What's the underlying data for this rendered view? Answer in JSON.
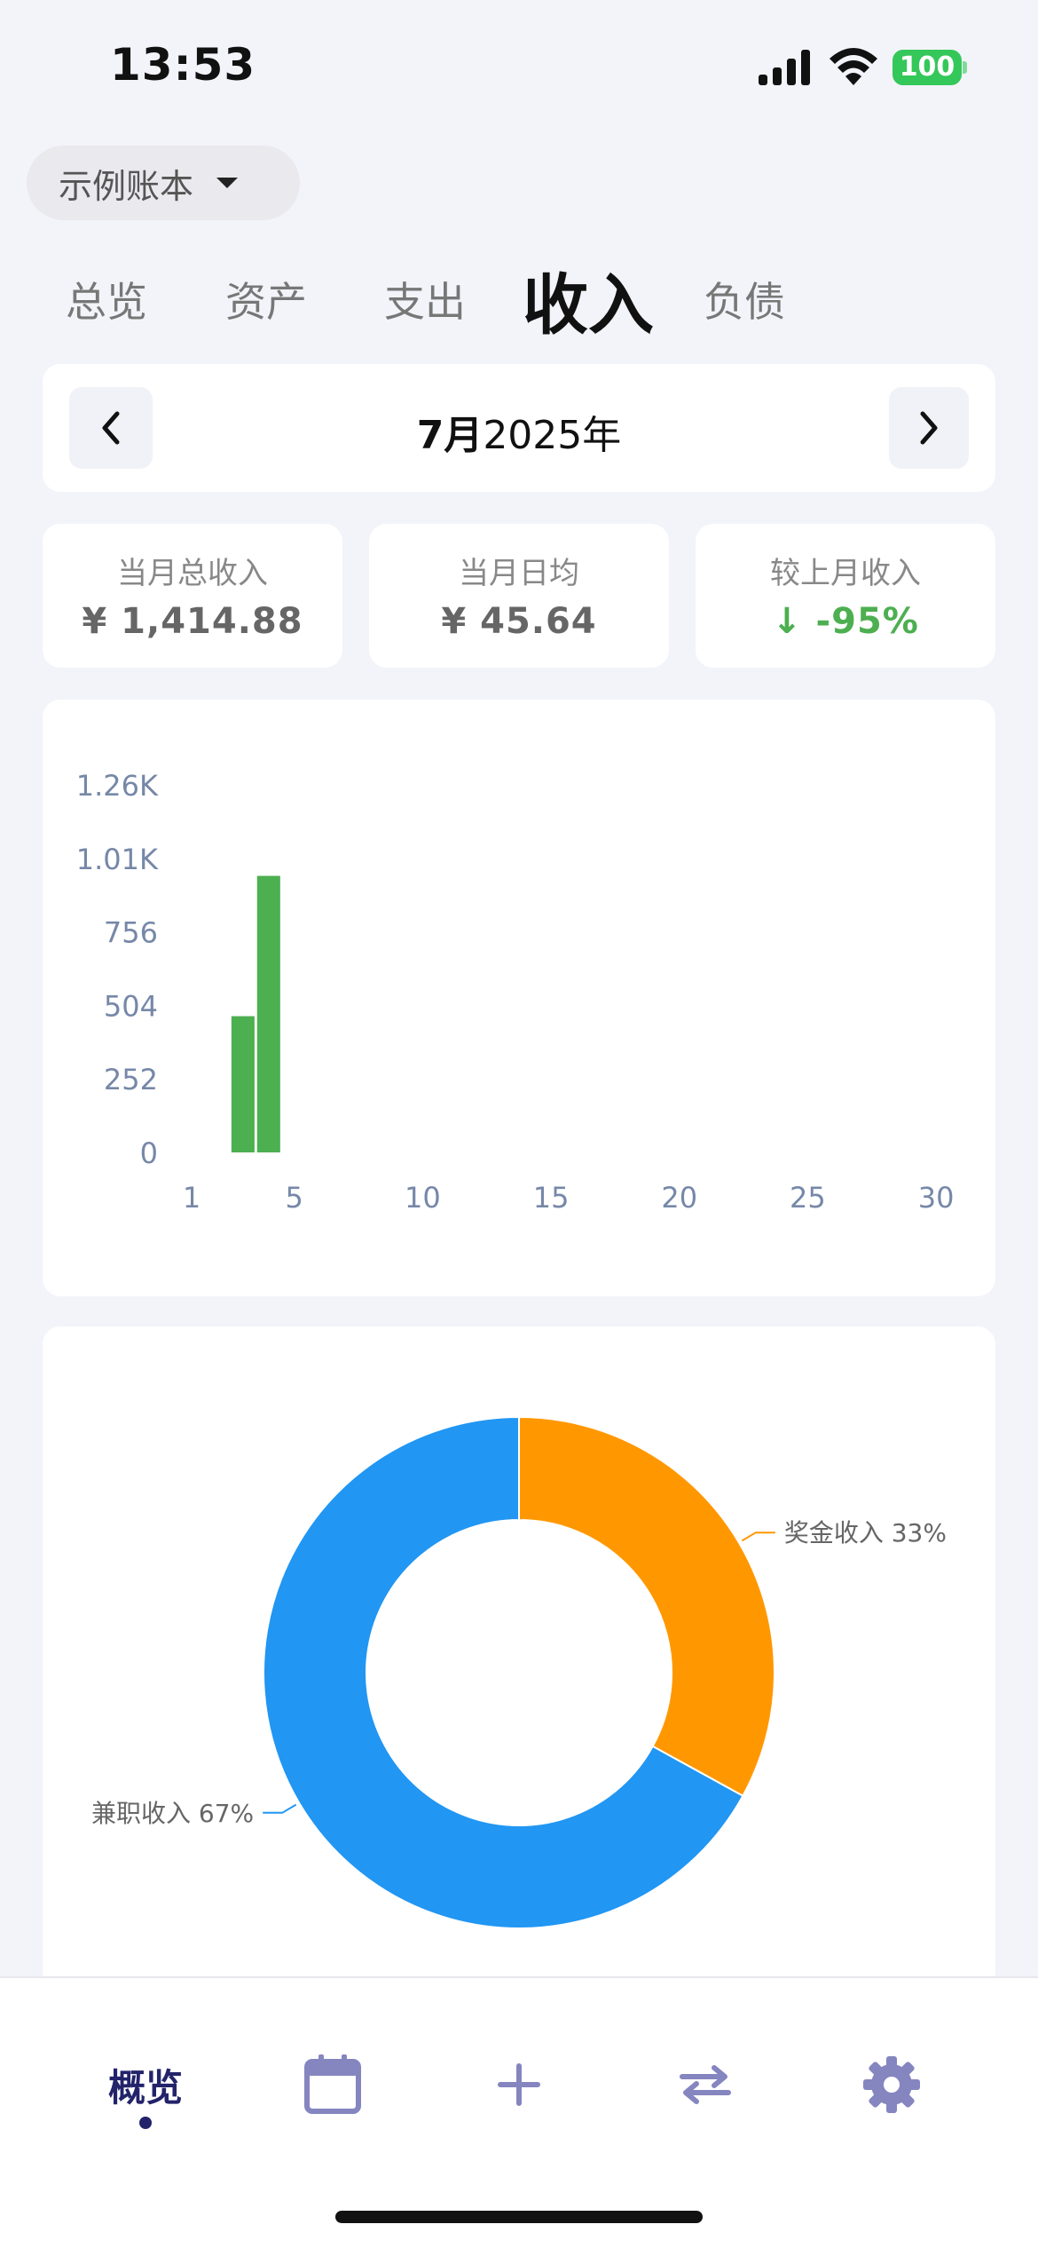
{
  "status_bar": {
    "time": "13:53",
    "battery": "100"
  },
  "book_selector": {
    "name": "示例账本"
  },
  "tabs": [
    {
      "label": "总览",
      "active": false
    },
    {
      "label": "资产",
      "active": false
    },
    {
      "label": "支出",
      "active": false
    },
    {
      "label": "收入",
      "active": true
    },
    {
      "label": "负债",
      "active": false
    }
  ],
  "month_nav": {
    "month": "7月",
    "year": "2025年"
  },
  "stats": [
    {
      "label": "当月总收入",
      "value": "¥ 1,414.88"
    },
    {
      "label": "当月日均",
      "value": "¥ 45.64"
    },
    {
      "label": "较上月收入",
      "value": "↓ -95%"
    }
  ],
  "colors": {
    "bar": "#4caf50",
    "slice_bonus": "#ff9800",
    "slice_parttime": "#2196f3",
    "nav_active": "#23236b",
    "nav_icon": "#8585c0"
  },
  "chart_data": [
    {
      "type": "bar",
      "x": [
        3,
        4
      ],
      "values": [
        467,
        948
      ],
      "ytick_labels": [
        "0",
        "252",
        "504",
        "756",
        "1.01K",
        "1.26K"
      ],
      "yticks": [
        0,
        252,
        504,
        756,
        1008,
        1260
      ],
      "xticks": [
        1,
        5,
        10,
        15,
        20,
        25,
        30
      ],
      "xlim": [
        1,
        31
      ],
      "ylim": [
        0,
        1260
      ],
      "grid": false
    },
    {
      "type": "pie",
      "donut": true,
      "labels": [
        "奖金收入",
        "兼职收入"
      ],
      "percent_labels": [
        "33%",
        "67%"
      ],
      "values": [
        33,
        67
      ]
    }
  ],
  "bottom_nav": {
    "overview_label": "概览"
  }
}
